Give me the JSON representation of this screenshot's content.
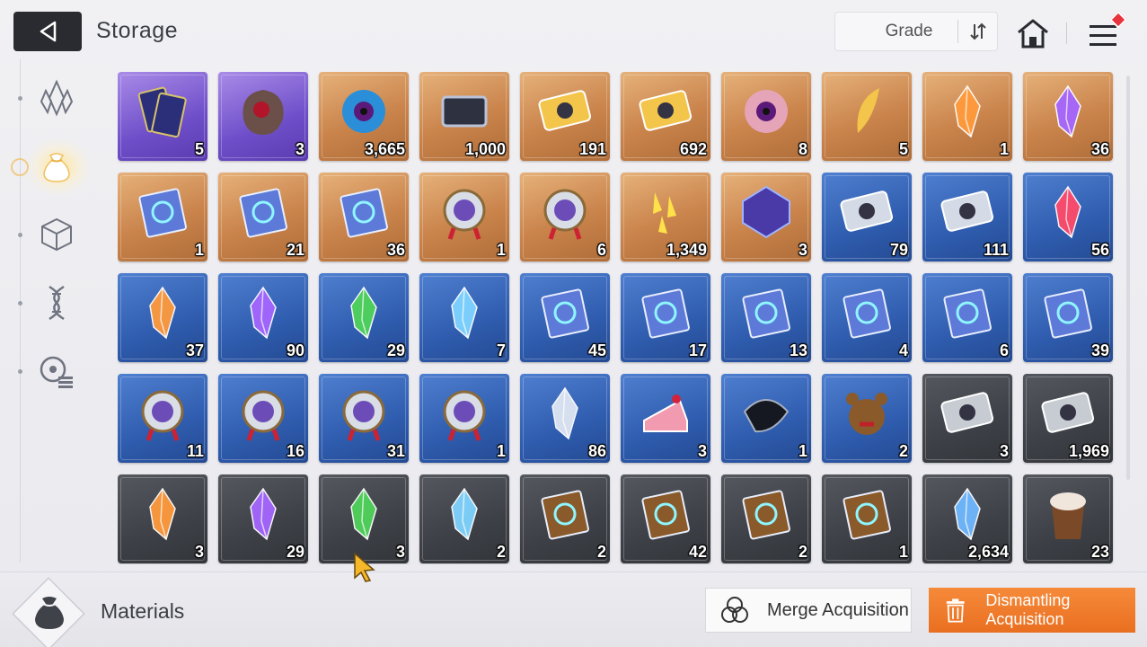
{
  "header": {
    "title": "Storage",
    "sort_label": "Grade"
  },
  "sidebar": {
    "items": [
      {
        "icon": "crystal-category-icon",
        "active": false
      },
      {
        "icon": "pouch-category-icon",
        "active": true
      },
      {
        "icon": "cube-category-icon",
        "active": false
      },
      {
        "icon": "dna-category-icon",
        "active": false
      },
      {
        "icon": "list-category-icon",
        "active": false
      }
    ]
  },
  "grid": {
    "rows": [
      [
        {
          "icon": "card-pack-icon",
          "rarity": "purple",
          "count": "5"
        },
        {
          "icon": "meteor-rock-icon",
          "rarity": "purple",
          "count": "3"
        },
        {
          "icon": "blue-tentacle-eye-icon",
          "rarity": "orange",
          "count": "3,665"
        },
        {
          "icon": "chip-icon",
          "rarity": "orange",
          "count": "1,000"
        },
        {
          "icon": "gold-portrait-ticket-icon",
          "rarity": "orange",
          "count": "191"
        },
        {
          "icon": "gold-star-ticket-icon",
          "rarity": "orange",
          "count": "692"
        },
        {
          "icon": "pink-eye-orb-icon",
          "rarity": "orange",
          "count": "8"
        },
        {
          "icon": "golden-feather-icon",
          "rarity": "orange",
          "count": "5"
        },
        {
          "icon": "orange-crystal-icon",
          "rarity": "orange",
          "count": "1"
        },
        {
          "icon": "purple-crystal-icon",
          "rarity": "orange",
          "count": "36"
        }
      ],
      [
        {
          "icon": "sword-manual-icon",
          "rarity": "orange",
          "count": "1"
        },
        {
          "icon": "shield-manual-icon",
          "rarity": "orange",
          "count": "21"
        },
        {
          "icon": "target-manual-icon",
          "rarity": "orange",
          "count": "36"
        },
        {
          "icon": "sword-medal-icon",
          "rarity": "orange",
          "count": "1"
        },
        {
          "icon": "lightning-medal-icon",
          "rarity": "orange",
          "count": "6"
        },
        {
          "icon": "gold-shards-icon",
          "rarity": "orange",
          "count": "1,349"
        },
        {
          "icon": "purple-cube-icon",
          "rarity": "orange",
          "count": "3"
        },
        {
          "icon": "silver-portrait-ticket-icon",
          "rarity": "blue",
          "count": "79"
        },
        {
          "icon": "silver-star-ticket-icon",
          "rarity": "blue",
          "count": "111"
        },
        {
          "icon": "red-crystal-icon",
          "rarity": "blue",
          "count": "56"
        }
      ],
      [
        {
          "icon": "orange-crystal-icon",
          "rarity": "blue",
          "count": "37"
        },
        {
          "icon": "purple-crystal-icon",
          "rarity": "blue",
          "count": "90"
        },
        {
          "icon": "green-crystal-icon",
          "rarity": "blue",
          "count": "29"
        },
        {
          "icon": "cyan-crystal-icon",
          "rarity": "blue",
          "count": "7"
        },
        {
          "icon": "sword-manual-icon",
          "rarity": "blue",
          "count": "45"
        },
        {
          "icon": "shield-manual-icon",
          "rarity": "blue",
          "count": "17"
        },
        {
          "icon": "target-manual-icon",
          "rarity": "blue",
          "count": "13"
        },
        {
          "icon": "wing-manual-icon",
          "rarity": "blue",
          "count": "4"
        },
        {
          "icon": "lightning-manual-icon",
          "rarity": "blue",
          "count": "6"
        },
        {
          "icon": "sphere-manual-icon",
          "rarity": "blue",
          "count": "39"
        }
      ],
      [
        {
          "icon": "sword-medal-icon",
          "rarity": "blue",
          "count": "11"
        },
        {
          "icon": "shield-medal-icon",
          "rarity": "blue",
          "count": "16"
        },
        {
          "icon": "target-medal-icon",
          "rarity": "blue",
          "count": "31"
        },
        {
          "icon": "lightning-medal-icon",
          "rarity": "blue",
          "count": "1"
        },
        {
          "icon": "ice-crystal-icon",
          "rarity": "blue",
          "count": "86"
        },
        {
          "icon": "cake-slice-icon",
          "rarity": "blue",
          "count": "3"
        },
        {
          "icon": "black-beetle-icon",
          "rarity": "blue",
          "count": "1"
        },
        {
          "icon": "teddy-bear-icon",
          "rarity": "blue",
          "count": "2"
        },
        {
          "icon": "grey-portrait-ticket-icon",
          "rarity": "grey",
          "count": "3"
        },
        {
          "icon": "grey-star-ticket-icon",
          "rarity": "grey",
          "count": "1,969"
        }
      ],
      [
        {
          "icon": "orange-crystal-icon",
          "rarity": "grey",
          "count": "3"
        },
        {
          "icon": "purple-crystal-icon",
          "rarity": "grey",
          "count": "29"
        },
        {
          "icon": "green-crystal-icon",
          "rarity": "grey",
          "count": "3"
        },
        {
          "icon": "cyan-crystal-icon",
          "rarity": "grey",
          "count": "2"
        },
        {
          "icon": "shield-book-icon",
          "rarity": "grey",
          "count": "2"
        },
        {
          "icon": "target-book-icon",
          "rarity": "grey",
          "count": "42"
        },
        {
          "icon": "lightning-book-icon",
          "rarity": "grey",
          "count": "2"
        },
        {
          "icon": "sphere-book-icon",
          "rarity": "grey",
          "count": "1"
        },
        {
          "icon": "blue-crystal-cluster-icon",
          "rarity": "grey",
          "count": "2,634"
        },
        {
          "icon": "iced-coffee-icon",
          "rarity": "grey",
          "count": "23"
        }
      ]
    ]
  },
  "footer": {
    "category_label": "Materials",
    "merge_label": "Merge Acquisition",
    "dismantle_label": "Dismantling Acquisition"
  },
  "colors": {
    "accent_orange": "#ea6f20",
    "back_button": "#2a2b30",
    "badge_red": "#e8323c"
  }
}
